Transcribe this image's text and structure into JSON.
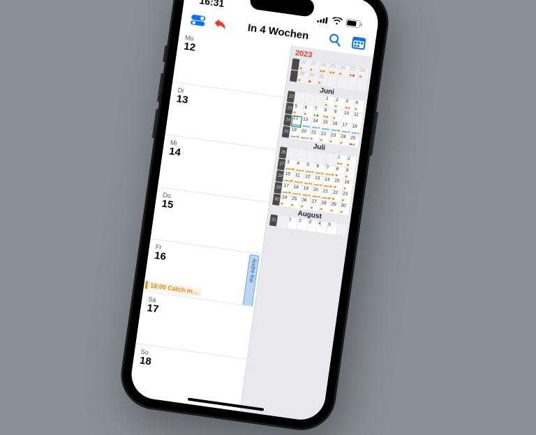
{
  "status": {
    "time": "16:31"
  },
  "nav": {
    "title": "In 4 Wochen"
  },
  "week": {
    "days": [
      {
        "wd": "Mo",
        "num": "12"
      },
      {
        "wd": "Di",
        "num": "13"
      },
      {
        "wd": "Mi",
        "num": "14"
      },
      {
        "wd": "Do",
        "num": "15"
      },
      {
        "wd": "Fr",
        "num": "16",
        "event_time": "18:00",
        "event_title": "Catch m…",
        "vbar_label": "Andre frei"
      },
      {
        "wd": "Sa",
        "num": "17"
      },
      {
        "wd": "So",
        "num": "18"
      }
    ]
  },
  "minical": {
    "year": "2023",
    "months": [
      {
        "label": "Juni",
        "pre_weeks": [
          {
            "wk": "",
            "cells": [
              {
                "d": "22",
                "dim": true,
                "dots": [
                  "o"
                ]
              },
              {
                "d": "23",
                "dim": true,
                "dots": [
                  "o"
                ]
              },
              {
                "d": "24",
                "dim": true,
                "dots": [
                  "o",
                  "o"
                ]
              },
              {
                "d": "25",
                "dim": true,
                "dots": [
                  "o",
                  "o"
                ]
              },
              {
                "d": "26",
                "dim": true,
                "dots": [
                  "o"
                ]
              },
              {
                "d": "27",
                "dim": true,
                "dots": [
                  "o",
                  "r"
                ]
              },
              {
                "d": "28",
                "dim": true,
                "dots": [
                  "o"
                ]
              }
            ]
          },
          {
            "wk": "",
            "cells": [
              {
                "d": "29",
                "dim": true,
                "dots": [
                  "o"
                ]
              },
              {
                "d": "30",
                "dim": true,
                "dots": [
                  "r"
                ]
              },
              {
                "d": "31",
                "dim": true,
                "dots": [
                  "o"
                ]
              },
              {
                "d": "",
                "dim": true
              },
              {
                "d": "",
                "dim": true
              },
              {
                "d": "",
                "dim": true
              },
              {
                "d": "",
                "dim": true
              }
            ]
          }
        ],
        "weeks": [
          {
            "wk": "22",
            "cells": [
              {
                "d": "",
                "dim": true
              },
              {
                "d": "",
                "dim": true
              },
              {
                "d": "",
                "dim": true
              },
              {
                "d": "1",
                "dots": [
                  "o"
                ]
              },
              {
                "d": "2",
                "dots": [
                  "o"
                ]
              },
              {
                "d": "3",
                "dots": [
                  "o",
                  "o"
                ]
              },
              {
                "d": "4",
                "dots": [
                  "o"
                ]
              }
            ]
          },
          {
            "wk": "23",
            "cells": [
              {
                "d": "5",
                "dots": [
                  "o"
                ]
              },
              {
                "d": "6",
                "dots": [
                  "o"
                ]
              },
              {
                "d": "7",
                "dots": [
                  "o",
                  "g"
                ]
              },
              {
                "d": "8",
                "dots": [
                  "o",
                  "o"
                ]
              },
              {
                "d": "9",
                "dots": [
                  "o"
                ]
              },
              {
                "d": "10",
                "dots": []
              },
              {
                "d": "11",
                "dots": []
              }
            ]
          },
          {
            "wk": "24",
            "cells": [
              {
                "d": "12",
                "today": true,
                "dots": [],
                "bars": [
                  "bb"
                ]
              },
              {
                "d": "13",
                "dots": [],
                "bars": [
                  "bb"
                ]
              },
              {
                "d": "14",
                "dots": [
                  "o"
                ],
                "bars": [
                  "bb"
                ]
              },
              {
                "d": "15",
                "dots": [],
                "bars": [
                  "bb"
                ]
              },
              {
                "d": "16",
                "dots": [
                  "o"
                ],
                "bars": [
                  "bb"
                ]
              },
              {
                "d": "17",
                "dots": [
                  "o"
                ],
                "bars": [
                  "bb"
                ]
              },
              {
                "d": "18",
                "dots": [
                  "o"
                ],
                "bars": [
                  "bb"
                ]
              }
            ]
          },
          {
            "wk": "25",
            "cells": [
              {
                "d": "19",
                "dots": [
                  "o"
                ],
                "bars": [
                  "bb"
                ]
              },
              {
                "d": "20",
                "dots": [
                  "o"
                ],
                "bars": [
                  "bb"
                ]
              },
              {
                "d": "21",
                "dots": [
                  "o"
                ]
              },
              {
                "d": "22",
                "dots": [
                  "o"
                ]
              },
              {
                "d": "23",
                "dots": [
                  "o"
                ]
              },
              {
                "d": "24",
                "dots": [
                  "o"
                ]
              },
              {
                "d": "25",
                "dots": [
                  "r",
                  "o"
                ]
              }
            ]
          }
        ]
      },
      {
        "label": "Juli",
        "weeks": [
          {
            "wk": "26",
            "cells": [
              {
                "d": "",
                "dim": true
              },
              {
                "d": "",
                "dim": true
              },
              {
                "d": "",
                "dim": true
              },
              {
                "d": "",
                "dim": true
              },
              {
                "d": "",
                "dim": true
              },
              {
                "d": "1",
                "dots": [
                  "o",
                  "o"
                ]
              },
              {
                "d": "2",
                "dots": [
                  "o"
                ]
              }
            ]
          },
          {
            "wk": "27",
            "cells": [
              {
                "d": "3",
                "dots": [
                  "o"
                ],
                "bars": [
                  "bo"
                ]
              },
              {
                "d": "4",
                "dots": [
                  "o"
                ],
                "bars": [
                  "bo"
                ]
              },
              {
                "d": "5",
                "dots": [
                  "o"
                ],
                "bars": [
                  "bo"
                ]
              },
              {
                "d": "6",
                "dots": [
                  "o"
                ],
                "bars": [
                  "bo"
                ]
              },
              {
                "d": "7",
                "dots": [
                  "o"
                ],
                "bars": [
                  "bo"
                ]
              },
              {
                "d": "8",
                "dots": [
                  "o"
                ]
              },
              {
                "d": "9",
                "dots": [
                  "o"
                ]
              }
            ]
          },
          {
            "wk": "28",
            "cells": [
              {
                "d": "10",
                "dots": [
                  "o"
                ],
                "bars": [
                  "bo"
                ]
              },
              {
                "d": "11",
                "dots": [
                  "o"
                ],
                "bars": [
                  "bo"
                ]
              },
              {
                "d": "12",
                "dots": [
                  "g",
                  "o"
                ],
                "bars": [
                  "bo"
                ]
              },
              {
                "d": "13",
                "dots": [
                  "o"
                ],
                "bars": [
                  "bo"
                ]
              },
              {
                "d": "14",
                "dots": [
                  "o"
                ],
                "bars": [
                  "bo"
                ]
              },
              {
                "d": "15",
                "dots": [
                  "o"
                ]
              },
              {
                "d": "16",
                "dots": [
                  "o"
                ]
              }
            ]
          },
          {
            "wk": "29",
            "cells": [
              {
                "d": "17",
                "dots": [
                  "o"
                ],
                "bars": [
                  "bo"
                ]
              },
              {
                "d": "18",
                "dots": [
                  "o"
                ],
                "bars": [
                  "bo"
                ]
              },
              {
                "d": "19",
                "dots": [
                  "o"
                ],
                "bars": [
                  "bo"
                ]
              },
              {
                "d": "20",
                "dots": [
                  "o"
                ],
                "bars": [
                  "bo"
                ]
              },
              {
                "d": "21",
                "dots": [
                  "o"
                ],
                "bars": [
                  "bo"
                ]
              },
              {
                "d": "22",
                "dots": [
                  "o"
                ]
              },
              {
                "d": "23",
                "dots": [
                  "o"
                ]
              }
            ]
          },
          {
            "wk": "30",
            "cells": [
              {
                "d": "24",
                "dots": [
                  "o"
                ]
              },
              {
                "d": "25",
                "dots": [
                  "o"
                ]
              },
              {
                "d": "26",
                "dots": [
                  "o"
                ]
              },
              {
                "d": "27",
                "dots": [
                  "o"
                ]
              },
              {
                "d": "28",
                "dots": [
                  "o"
                ]
              },
              {
                "d": "29",
                "dots": [
                  "o"
                ]
              },
              {
                "d": "30",
                "dots": [
                  "o"
                ]
              }
            ]
          }
        ]
      },
      {
        "label": "August",
        "weeks": [
          {
            "wk": "31",
            "cells": [
              {
                "d": "",
                "dim": true
              },
              {
                "d": "1",
                "dots": []
              },
              {
                "d": "2",
                "dots": []
              },
              {
                "d": "3",
                "dots": []
              },
              {
                "d": "4",
                "dots": []
              },
              {
                "d": "5",
                "dots": []
              },
              {
                "d": "",
                "dim": true
              }
            ]
          }
        ]
      }
    ]
  }
}
